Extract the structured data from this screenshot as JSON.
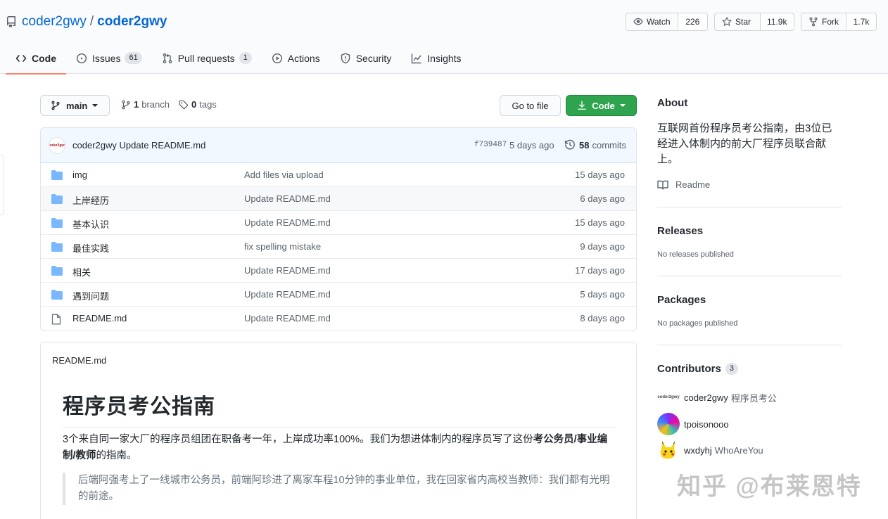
{
  "repo": {
    "owner": "coder2gwy",
    "separator": "/",
    "name": "coder2gwy"
  },
  "actions": {
    "watch": {
      "label": "Watch",
      "count": "226"
    },
    "star": {
      "label": "Star",
      "count": "11.9k"
    },
    "fork": {
      "label": "Fork",
      "count": "1.7k"
    }
  },
  "tabs": [
    {
      "label": "Code",
      "icon": "code-icon",
      "selected": true
    },
    {
      "label": "Issues",
      "icon": "issue-icon",
      "badge": "61"
    },
    {
      "label": "Pull requests",
      "icon": "pull-request-icon",
      "badge": "1"
    },
    {
      "label": "Actions",
      "icon": "play-icon"
    },
    {
      "label": "Security",
      "icon": "shield-icon"
    },
    {
      "label": "Insights",
      "icon": "graph-icon"
    }
  ],
  "toolbar": {
    "branch": "main",
    "branch_count": "1",
    "branch_label": "branch",
    "tag_count": "0",
    "tag_label": "tags",
    "goto_file": "Go to file",
    "code": "Code"
  },
  "latest_commit": {
    "avatar_text": "coder2gwy",
    "author": "coder2gwy",
    "message": "Update README.md",
    "sha": "f739487",
    "when": "5 days ago",
    "commit_count": "58",
    "commit_label": "commits"
  },
  "files": [
    {
      "type": "dir",
      "name": "img",
      "message": "Add files via upload",
      "age": "15 days ago"
    },
    {
      "type": "dir",
      "name": "上岸经历",
      "message": "Update README.md",
      "age": "6 days ago"
    },
    {
      "type": "dir",
      "name": "基本认识",
      "message": "Update README.md",
      "age": "15 days ago"
    },
    {
      "type": "dir",
      "name": "最佳实践",
      "message": "fix spelling mistake",
      "age": "9 days ago"
    },
    {
      "type": "dir",
      "name": "相关",
      "message": "Update README.md",
      "age": "17 days ago"
    },
    {
      "type": "dir",
      "name": "遇到问题",
      "message": "Update README.md",
      "age": "5 days ago"
    },
    {
      "type": "file",
      "name": "README.md",
      "message": "Update README.md",
      "age": "8 days ago"
    }
  ],
  "readme": {
    "filename": "README.md",
    "title": "程序员考公指南",
    "para_a": "3个来自同一家大厂的程序员组团在职备考一年，上岸成功率100%。我们为想进体制内的程序员写了这份",
    "para_bold": "考公务员/事业编制/教师",
    "para_b": "的指南。",
    "quote": "后端阿强考上了一线城市公务员，前端阿珍进了离家车程10分钟的事业单位，我在回家省内高校当教师：我们都有光明的前途。"
  },
  "sidebar": {
    "about_title": "About",
    "about_desc": "互联网首份程序员考公指南，由3位已经进入体制内的前大厂程序员联合献上。",
    "readme_link": "Readme",
    "releases_title": "Releases",
    "releases_note": "No releases published",
    "packages_title": "Packages",
    "packages_note": "No packages published",
    "contributors_title": "Contributors",
    "contributors_count": "3",
    "contributors": [
      {
        "avatar_text": "coder2gwy",
        "login": "coder2gwy",
        "real": "程序员考公"
      },
      {
        "login": "tpoisonooo",
        "real": ""
      },
      {
        "login": "wxdyhj",
        "real": "WhoAreYou"
      }
    ]
  },
  "watermark": "知乎 @布莱恩特",
  "colors": {
    "link": "#0366d6",
    "primary_button": "#2ea44f",
    "tab_underline": "#f9826c",
    "folder": "#79b8ff"
  }
}
